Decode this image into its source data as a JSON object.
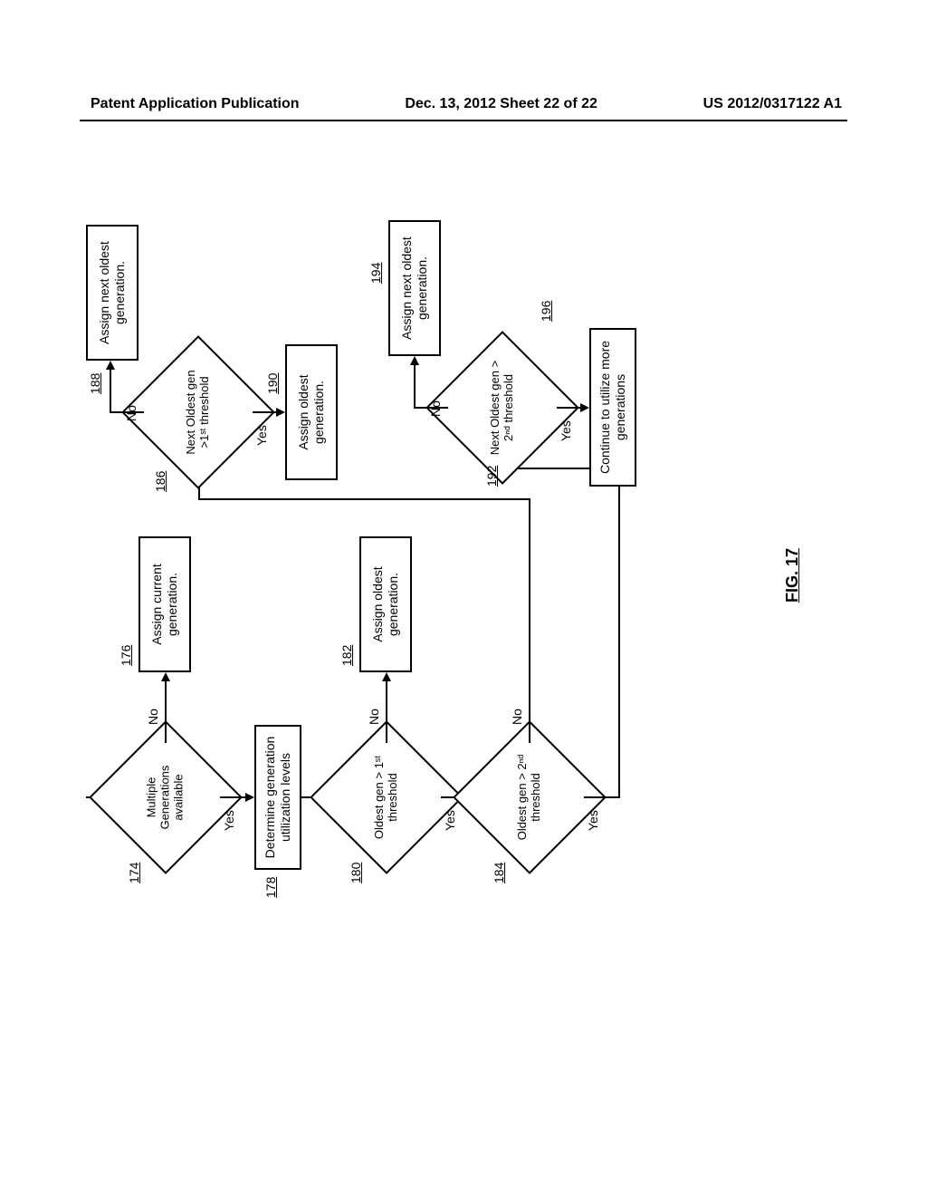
{
  "header": {
    "left": "Patent Application Publication",
    "center": "Dec. 13, 2012  Sheet 22 of 22",
    "right": "US 2012/0317122 A1"
  },
  "chart_data": {
    "type": "flowchart",
    "figure_label": "FIG. 17",
    "nodes": [
      {
        "id": "174",
        "kind": "decision",
        "text": "Multiple Generations available"
      },
      {
        "id": "176",
        "kind": "process",
        "text": "Assign current generation."
      },
      {
        "id": "178",
        "kind": "process",
        "text": "Determine generation utilization levels"
      },
      {
        "id": "180",
        "kind": "decision",
        "text": "Oldest gen > 1st threshold"
      },
      {
        "id": "182",
        "kind": "process",
        "text": "Assign oldest generation."
      },
      {
        "id": "184",
        "kind": "decision",
        "text": "Oldest gen > 2nd threshold"
      },
      {
        "id": "186",
        "kind": "decision",
        "text": "Next Oldest gen > 1st threshold"
      },
      {
        "id": "188",
        "kind": "process",
        "text": "Assign next oldest generation."
      },
      {
        "id": "190",
        "kind": "process",
        "text": "Assign oldest generation."
      },
      {
        "id": "192",
        "kind": "decision",
        "text": "Next Oldest gen > 2nd threshold"
      },
      {
        "id": "194",
        "kind": "process",
        "text": "Assign next oldest generation."
      },
      {
        "id": "196",
        "kind": "process",
        "text": "Continue to utilize more generations"
      }
    ],
    "edges": [
      {
        "from": "start",
        "to": "174"
      },
      {
        "from": "174",
        "to": "176",
        "label": "No"
      },
      {
        "from": "174",
        "to": "178",
        "label": "Yes"
      },
      {
        "from": "178",
        "to": "180"
      },
      {
        "from": "180",
        "to": "182",
        "label": "No"
      },
      {
        "from": "180",
        "to": "184",
        "label": "Yes"
      },
      {
        "from": "184",
        "to": "186",
        "label": "No"
      },
      {
        "from": "184",
        "to": "192",
        "label": "Yes"
      },
      {
        "from": "186",
        "to": "188",
        "label": "No"
      },
      {
        "from": "186",
        "to": "190",
        "label": "Yes"
      },
      {
        "from": "192",
        "to": "194",
        "label": "No"
      },
      {
        "from": "192",
        "to": "196",
        "label": "Yes"
      }
    ]
  },
  "nodes": {
    "n174": "Multiple Generations available",
    "n176": "Assign current generation.",
    "n178": "Determine generation utilization levels",
    "n180": "Oldest gen > 1ˢᵗ threshold",
    "n182": "Assign oldest generation.",
    "n184": "Oldest gen > 2ⁿᵈ threshold",
    "n186": "Next Oldest gen >1ˢᵗ threshold",
    "n188": "Assign next oldest generation.",
    "n190": "Assign oldest generation.",
    "n192": "Next Oldest gen > 2ⁿᵈ threshold",
    "n194": "Assign next oldest generation.",
    "n196": "Continue to utilize more generations"
  },
  "refs": {
    "r174": "174",
    "r176": "176",
    "r178": "178",
    "r180": "180",
    "r182": "182",
    "r184": "184",
    "r186": "186",
    "r188": "188",
    "r190": "190",
    "r192": "192",
    "r194": "194",
    "r196": "196"
  },
  "labels": {
    "yes": "Yes",
    "no": "No"
  },
  "fig": "FIG. 17"
}
